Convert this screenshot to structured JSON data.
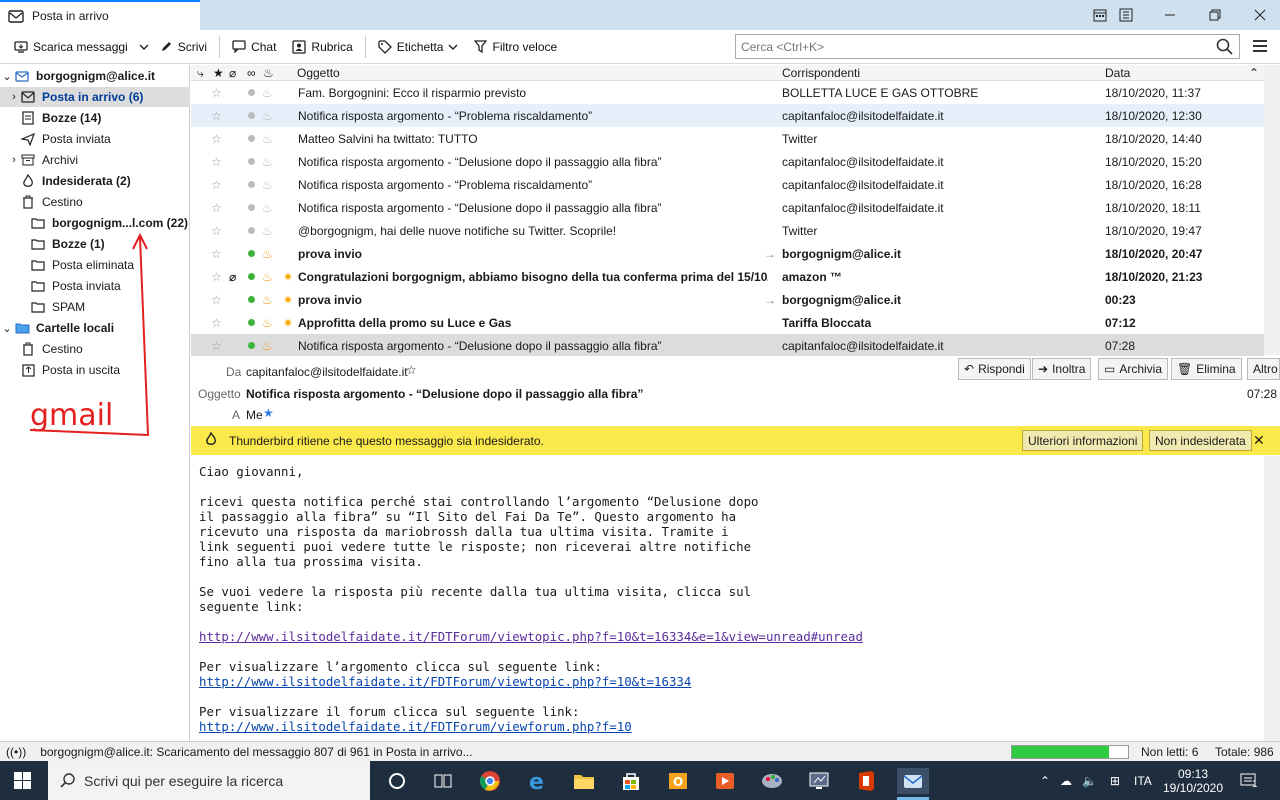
{
  "app": {
    "tab_title": "Posta in arrivo"
  },
  "toolbar": {
    "get_messages": "Scarica messaggi",
    "write": "Scrivi",
    "chat": "Chat",
    "address_book": "Rubrica",
    "tag": "Etichetta",
    "quick_filter": "Filtro veloce",
    "search_placeholder": "Cerca <Ctrl+K>"
  },
  "folders": {
    "account1": "borgognigm@alice.it",
    "inbox": "Posta in arrivo (6)",
    "drafts": "Bozze (14)",
    "sent": "Posta inviata",
    "archives": "Archivi",
    "junk": "Indesiderata (2)",
    "trash": "Cestino",
    "gmail": "borgognigm...l.com (22)",
    "drafts2": "Bozze (1)",
    "deleted": "Posta eliminata",
    "sent2": "Posta inviata",
    "spam": "SPAM",
    "local": "Cartelle locali",
    "local_trash": "Cestino",
    "outbox": "Posta in uscita"
  },
  "list": {
    "col_subject": "Oggetto",
    "col_correspondents": "Corrispondenti",
    "col_date": "Data",
    "rows": [
      {
        "subject": "Fam. Borgognini: Ecco il risparmio previsto",
        "corr": "BOLLETTA LUCE E GAS OTTOBRE",
        "date": "18/10/2020, 11:37"
      },
      {
        "subject": "Notifica risposta argomento - “Problema riscaldamento”",
        "corr": "capitanfaloc@ilsitodelfaidate.it",
        "date": "18/10/2020, 12:30"
      },
      {
        "subject": "Matteo Salvini ha twittato: TUTTO",
        "corr": "Twitter",
        "date": "18/10/2020, 14:40"
      },
      {
        "subject": "Notifica risposta argomento - “Delusione dopo il passaggio alla fibra”",
        "corr": "capitanfaloc@ilsitodelfaidate.it",
        "date": "18/10/2020, 15:20"
      },
      {
        "subject": "Notifica risposta argomento - “Problema riscaldamento”",
        "corr": "capitanfaloc@ilsitodelfaidate.it",
        "date": "18/10/2020, 16:28"
      },
      {
        "subject": "Notifica risposta argomento - “Delusione dopo il passaggio alla fibra”",
        "corr": "capitanfaloc@ilsitodelfaidate.it",
        "date": "18/10/2020, 18:11"
      },
      {
        "subject": "@borgognigm, hai delle nuove notifiche su Twitter. Scoprile!",
        "corr": "Twitter",
        "date": "18/10/2020, 19:47"
      },
      {
        "subject": "prova invio",
        "corr": "borgognigm@alice.it",
        "date": "18/10/2020, 20:47"
      },
      {
        "subject": "Congratulazioni borgognigm, abbiamo bisogno della tua conferma prima del 15/10/...",
        "corr": "amazon ™",
        "date": "18/10/2020, 21:23"
      },
      {
        "subject": "prova invio",
        "corr": "borgognigm@alice.it",
        "date": "00:23"
      },
      {
        "subject": "Approfitta della promo su Luce e Gas",
        "corr": "Tariffa Bloccata",
        "date": "07:12"
      },
      {
        "subject": "Notifica risposta argomento - “Delusione dopo il passaggio alla fibra”",
        "corr": "capitanfaloc@ilsitodelfaidate.it",
        "date": "07:28"
      }
    ]
  },
  "header": {
    "from_label": "Da",
    "from": "capitanfaloc@ilsitodelfaidate.it",
    "subject_label": "Oggetto",
    "subject": "Notifica risposta argomento - “Delusione dopo il passaggio alla fibra”",
    "to_label": "A",
    "to": "Me",
    "time": "07:28",
    "reply": "Rispondi",
    "forward": "Inoltra",
    "archive": "Archivia",
    "delete": "Elimina",
    "more": "Altro"
  },
  "junkbar": {
    "text": "Thunderbird ritiene che questo messaggio sia indesiderato.",
    "more_info": "Ulteriori informazioni",
    "not_junk": "Non indesiderata"
  },
  "body": {
    "greeting": "Ciao giovanni,",
    "p1": "ricevi questa notifica perché stai controllando l’argomento “Delusione dopo\nil passaggio alla fibra” su “Il Sito del Fai Da Te”. Questo argomento ha\nricevuto una risposta da mariobrossh dalla tua ultima visita. Tramite i\nlink seguenti puoi vedere tutte le risposte; non riceverai altre notifiche\nfino alla tua prossima visita.",
    "p2": "Se vuoi vedere la risposta più recente dalla tua ultima visita, clicca sul\nseguente link:",
    "link1": "http://www.ilsitodelfaidate.it/FDTForum/viewtopic.php?f=10&t=16334&e=1&view=unread#unread",
    "p3": "Per visualizzare l’argomento clicca sul seguente link:",
    "link2": "http://www.ilsitodelfaidate.it/FDTForum/viewtopic.php?f=10&t=16334",
    "p4": "Per visualizzare il forum clicca sul seguente link:",
    "link3": "http://www.ilsitodelfaidate.it/FDTForum/viewforum.php?f=10"
  },
  "status": {
    "text": "borgognigm@alice.it: Scaricamento del messaggio 807 di 961 in Posta in arrivo...",
    "progress": 0.84,
    "unread": "Non letti: 6",
    "total": "Totale: 986"
  },
  "taskbar": {
    "search": "Scrivi qui per eseguire la ricerca",
    "lang": "ITA",
    "time": "09:13",
    "date": "19/10/2020",
    "notif": "1"
  },
  "annotation": "gmail"
}
